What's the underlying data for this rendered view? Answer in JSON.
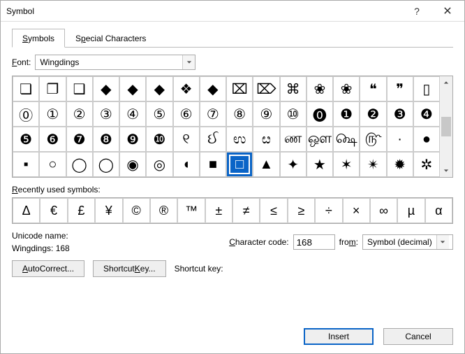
{
  "window": {
    "title": "Symbol"
  },
  "tabs": {
    "symbols": "Symbols",
    "special": "Special Characters"
  },
  "font": {
    "label": "Font:",
    "value": "Wingdings"
  },
  "grid": [
    [
      "❏",
      "❐",
      "❑",
      "◆",
      "◆",
      "◆",
      "❖",
      "◆",
      "⌧",
      "⌦",
      "⌘",
      "❀",
      "❀",
      "❝",
      "❞",
      "▯"
    ],
    [
      "⓪",
      "①",
      "②",
      "③",
      "④",
      "⑤",
      "⑥",
      "⑦",
      "⑧",
      "⑨",
      "⑩",
      "⓿",
      "❶",
      "❷",
      "❸",
      "❹"
    ],
    [
      "❺",
      "❻",
      "❼",
      "❽",
      "❾",
      "❿",
      "୧",
      "ઈ",
      "ಉ",
      "ೞ",
      "ண",
      "ஔ",
      "௸",
      "௹",
      "·",
      "●"
    ],
    [
      "▪",
      "○",
      "◯",
      "◯",
      "◉",
      "◎",
      "◖",
      "■",
      "□",
      "▲",
      "✦",
      "★",
      "✶",
      "✴",
      "✹",
      "✲"
    ]
  ],
  "selected": {
    "row": 3,
    "col": 8
  },
  "recent": {
    "label": "Recently used symbols:",
    "items": [
      "Δ",
      "€",
      "£",
      "¥",
      "©",
      "®",
      "™",
      "±",
      "≠",
      "≤",
      "≥",
      "÷",
      "×",
      "∞",
      "µ",
      "α"
    ]
  },
  "unicode": {
    "label": "Unicode name:",
    "value": "Wingdings: 168"
  },
  "charcode": {
    "label": "Character code:",
    "value": "168"
  },
  "from": {
    "label": "from:",
    "value": "Symbol (decimal)"
  },
  "buttons": {
    "autocorrect": "AutoCorrect...",
    "shortcut": "Shortcut Key...",
    "shortcut_lbl": "Shortcut key:"
  },
  "footer": {
    "insert": "Insert",
    "cancel": "Cancel"
  }
}
